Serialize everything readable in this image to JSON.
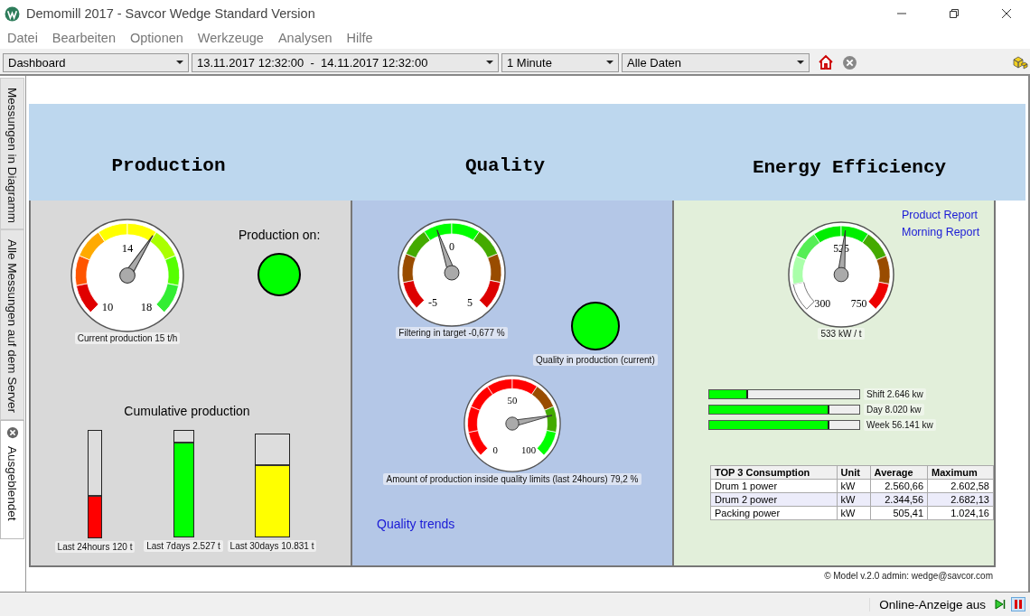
{
  "window": {
    "title": "Demomill 2017 - Savcor Wedge Standard Version"
  },
  "menu": [
    "Datei",
    "Bearbeiten",
    "Optionen",
    "Werkzeuge",
    "Analysen",
    "Hilfe"
  ],
  "toolbar": {
    "view": "Dashboard",
    "range": "13.11.2017 12:32:00  -  14.11.2017 12:32:00",
    "interval": "1 Minute",
    "data": "Alle Daten"
  },
  "side_tabs": [
    {
      "label": "Messungen in Diagramm",
      "selected": false,
      "closable": false
    },
    {
      "label": "Alle Messungen auf dem Server",
      "selected": false,
      "closable": false
    },
    {
      "label": "Ausgeblendet",
      "selected": true,
      "closable": true
    }
  ],
  "sections": [
    "Production",
    "Quality",
    "Energy Efficiency"
  ],
  "production": {
    "gauge": {
      "min": "10",
      "mid": "14",
      "max": "18",
      "level": 0.62,
      "caption": "Current production 15 t/h",
      "zones": [
        {
          "color": "#e00000"
        },
        {
          "color": "#ff5500"
        },
        {
          "color": "#ffaa00"
        },
        {
          "color": "#ffff00"
        },
        {
          "color": "#ffff00"
        },
        {
          "color": "#aaff00"
        },
        {
          "color": "#55ff00"
        },
        {
          "color": "#33ee33"
        }
      ]
    },
    "status": {
      "label": "Production on:",
      "on": true
    },
    "cumulative_title": "Cumulative production",
    "cylinders": [
      {
        "label": "Last 24hours 120 t",
        "level": 0.4,
        "color": "#ff0000"
      },
      {
        "label": "Last 7days 2.527 t",
        "level": 0.9,
        "color": "#00ff00"
      },
      {
        "label": "Last 30days 10.831 t",
        "level": 0.71,
        "color": "#ffff00"
      }
    ]
  },
  "quality": {
    "gauge": {
      "min": "-5",
      "mid": "0",
      "max": "5",
      "level": 0.43,
      "caption": "Filtering in target -0,677 %",
      "zones": [
        {
          "color": "#dd0000"
        },
        {
          "color": "#994c00"
        },
        {
          "color": "#44aa00"
        },
        {
          "color": "#00ff00"
        },
        {
          "color": "#00ff00"
        },
        {
          "color": "#44aa00"
        },
        {
          "color": "#994c00"
        },
        {
          "color": "#dd0000"
        }
      ]
    },
    "status": {
      "label": "Quality in production (current)",
      "on": true
    },
    "gauge2": {
      "min": "0",
      "mid": "50",
      "max": "100",
      "level": 0.79,
      "caption": "Amount of production inside quality limits (last 24hours) 79,2 %",
      "zones": [
        {
          "color": "#ff0000"
        },
        {
          "color": "#ff0000"
        },
        {
          "color": "#ff0000"
        },
        {
          "color": "#ff0000"
        },
        {
          "color": "#ff0000"
        },
        {
          "color": "#994c00"
        },
        {
          "color": "#44aa00"
        },
        {
          "color": "#00ff00"
        }
      ]
    },
    "link": "Quality trends"
  },
  "energy": {
    "links": [
      "Product Report",
      "Morning Report"
    ],
    "gauge": {
      "min": "300",
      "mid": "525",
      "max": "750",
      "level": 0.52,
      "caption": "533 kW / t",
      "zones": [
        {
          "color": "#ffffff"
        },
        {
          "color": "#aaffaa"
        },
        {
          "color": "#55ee55"
        },
        {
          "color": "#00ee00"
        },
        {
          "color": "#00ee00"
        },
        {
          "color": "#44aa00"
        },
        {
          "color": "#994c00"
        },
        {
          "color": "#ee0000"
        }
      ]
    },
    "bars": [
      {
        "label": "Shift  2.646 kw",
        "level": 0.26
      },
      {
        "label": "Day 8.020 kw",
        "level": 0.8
      },
      {
        "label": "Week 56.141 kw",
        "level": 0.8
      }
    ],
    "table": {
      "columns": [
        "TOP 3 Consumption",
        "Unit",
        "Average",
        "Maximum"
      ],
      "rows": [
        [
          "Drum 1 power",
          "kW",
          "2.560,66",
          "2.602,58"
        ],
        [
          "Drum 2 power",
          "kW",
          "2.344,56",
          "2.682,13"
        ],
        [
          "Packing power",
          "kW",
          "505,41",
          "1.024,16"
        ]
      ]
    }
  },
  "footer": "© Model  v.2.0  admin: wedge@savcor.com",
  "status_bar": {
    "text": "Online-Anzeige aus"
  }
}
